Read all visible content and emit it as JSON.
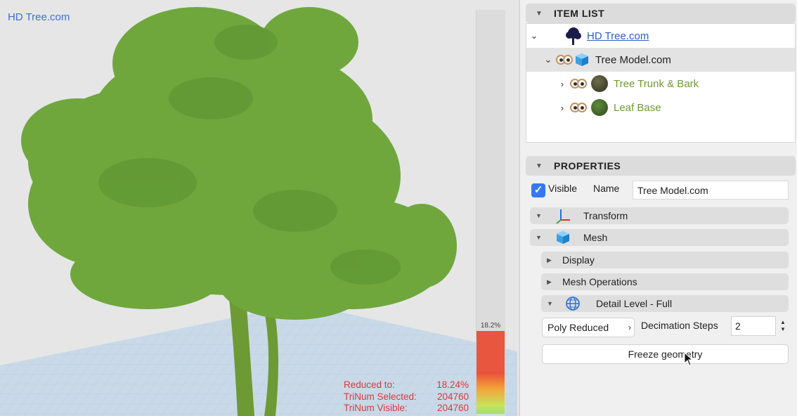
{
  "viewport": {
    "brand": "HD Tree.com",
    "meter_percent": "18.2%",
    "stats": [
      {
        "label": "Reduced to:",
        "value": "18.24%"
      },
      {
        "label": "TriNum Selected:",
        "value": "204760"
      },
      {
        "label": "TriNum Visible:",
        "value": "204760"
      }
    ],
    "colors": {
      "stats_text": "#d63a3a",
      "foliage": "#6fa73d",
      "meter_high": "#e8563f"
    }
  },
  "item_list": {
    "header": "ITEM LIST",
    "items": [
      {
        "label": "HD Tree.com",
        "level": 0,
        "expanded": true,
        "icon": "tree-silhouette-icon"
      },
      {
        "label": "Tree Model.com",
        "level": 1,
        "expanded": true,
        "icon": "mesh-cube-icon"
      },
      {
        "label": "Tree Trunk & Bark",
        "level": 2,
        "expanded": false,
        "icon": "bark-material-icon"
      },
      {
        "label": "Leaf Base",
        "level": 2,
        "expanded": false,
        "icon": "leaf-material-icon"
      }
    ]
  },
  "properties": {
    "header": "PROPERTIES",
    "visible_label": "Visible",
    "visible_checked": true,
    "name_label": "Name",
    "name_value": "Tree Model.com",
    "sections": {
      "transform": "Transform",
      "mesh": "Mesh",
      "display": "Display",
      "mesh_operations": "Mesh Operations",
      "detail_level": "Detail Level - Full"
    },
    "poly_reduced": "Poly Reduced",
    "decimation_label": "Decimation Steps",
    "decimation_value": "2",
    "freeze_label": "Freeze geometry"
  }
}
